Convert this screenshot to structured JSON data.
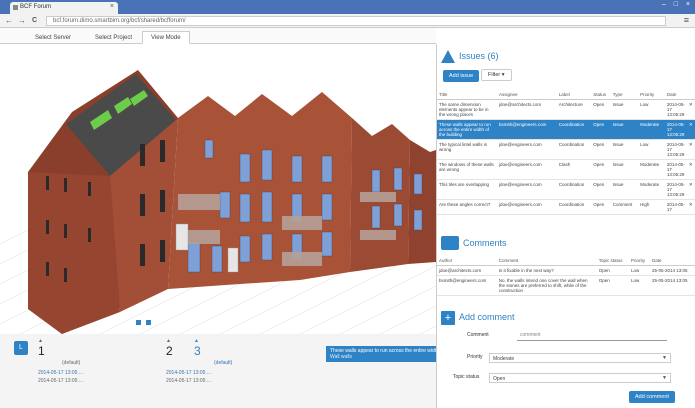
{
  "browser": {
    "tab_title": "BCF Forum",
    "tab_close": "×",
    "window_controls": "– □ ×",
    "url": "bcf.forum.dimo.smartbim.org/bcf/shared/bcfforum/",
    "back": "←",
    "forward": "→",
    "reload": "C",
    "menu": "≡"
  },
  "apptabs": [
    "Select Server",
    "Select Project",
    "View Mode"
  ],
  "viewpoints": [
    {
      "number": "1",
      "label": "(default)",
      "line1": "2014-05-17 13:05 ...",
      "line2": "2014-05-17 13:05 ..."
    },
    {
      "number": "2",
      "label": "",
      "line1": "",
      "line2": ""
    },
    {
      "number": "3",
      "label": "(default)",
      "line1": "2014-05-17 13:05 ...",
      "line2": "2014-05-17 13:05 ..."
    }
  ],
  "tooltip": {
    "text": "These walls appear to run across the entire width of the building",
    "sub": "Wall walls"
  },
  "issues": {
    "title": "Issues (6)",
    "add_button": "Add issue",
    "filter_button": "Filter ▾",
    "columns": [
      "Title",
      "Assignee",
      "Label",
      "Status",
      "Type",
      "Priority",
      "Date",
      ""
    ],
    "rows": [
      {
        "title": "The same dimension elements appear to be in the wrong places",
        "assignee": "jdoe@architects.com",
        "label": "Architecture",
        "status": "Open",
        "type": "Issue",
        "priority": "Low",
        "date": "2014-05-17 13:05:29",
        "x": "✕",
        "selected": false
      },
      {
        "title": "These walls appear to run across the entire width of the building",
        "assignee": "bsmith@engineers.com",
        "label": "Coordination",
        "status": "Open",
        "type": "Issue",
        "priority": "Moderate",
        "date": "2014-05-17 13:05:29",
        "x": "✕",
        "selected": true
      },
      {
        "title": "The typical lintel walls is wrong",
        "assignee": "jdoe@engineers.com",
        "label": "Coordination",
        "status": "Open",
        "type": "Issue",
        "priority": "Low",
        "date": "2014-05-17 13:05:29",
        "x": "✕",
        "selected": false
      },
      {
        "title": "The windows of these walls are wrong",
        "assignee": "jdoe@engineers.com",
        "label": "Clash",
        "status": "Open",
        "type": "Issue",
        "priority": "Moderate",
        "date": "2014-05-17 13:05:29",
        "x": "✕",
        "selected": false
      },
      {
        "title": "This tiles are overlapping",
        "assignee": "jdoe@engineers.com",
        "label": "Coordination",
        "status": "Open",
        "type": "Issue",
        "priority": "Moderate",
        "date": "2014-05-17 13:05:29",
        "x": "✕",
        "selected": false
      },
      {
        "title": "Are these angles correct?",
        "assignee": "jdoe@engineers.com",
        "label": "Coordination",
        "status": "Open",
        "type": "Comment",
        "priority": "High",
        "date": "2014-05-17",
        "x": "✕",
        "selected": false
      }
    ]
  },
  "comments": {
    "title": "Comments",
    "columns": [
      "Author",
      "Comment",
      "Topic status",
      "Priority",
      "Date"
    ],
    "rows": [
      {
        "author": "jdoe@architects.com",
        "comment": "Is it fixable in the next way?",
        "status": "Open",
        "priority": "Low",
        "date": "25-05-2014 13:05"
      },
      {
        "author": "bsmith@engineers.com",
        "comment": "No, the walls intend one cover the wall when the stones are preferred to shift, while of the construction",
        "status": "Open",
        "priority": "Low",
        "date": "25-05-2014 13:05"
      }
    ]
  },
  "add_comment": {
    "title": "Add comment",
    "plus": "+",
    "comment_label": "Comment",
    "comment_placeholder": "comment",
    "priority_label": "Priority",
    "priority_value": "Moderate",
    "status_label": "Topic status",
    "status_value": "Open",
    "submit": "Add comment"
  },
  "colors": {
    "accent": "#2e83c6",
    "brick": "#a34e37",
    "chrome": "#4a72b6"
  }
}
